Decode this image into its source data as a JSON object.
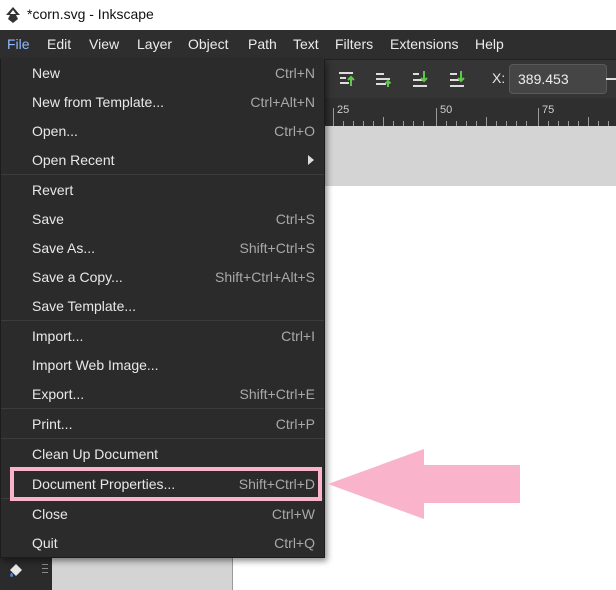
{
  "window": {
    "title": "*corn.svg - Inkscape"
  },
  "menubar": {
    "items": [
      "File",
      "Edit",
      "View",
      "Layer",
      "Object",
      "Path",
      "Text",
      "Filters",
      "Extensions",
      "Help"
    ]
  },
  "toolbar": {
    "x_label": "X:",
    "x_value": "389.453"
  },
  "ruler": {
    "labels": [
      "25",
      "50",
      "75"
    ]
  },
  "file_menu": {
    "items": [
      {
        "label": "New",
        "shortcut": "Ctrl+N"
      },
      {
        "label": "New from Template...",
        "shortcut": "Ctrl+Alt+N"
      },
      {
        "label": "Open...",
        "shortcut": "Ctrl+O"
      },
      {
        "label": "Open Recent",
        "shortcut": ""
      },
      {
        "label": "Revert",
        "shortcut": ""
      },
      {
        "label": "Save",
        "shortcut": "Ctrl+S"
      },
      {
        "label": "Save As...",
        "shortcut": "Shift+Ctrl+S"
      },
      {
        "label": "Save a Copy...",
        "shortcut": "Shift+Ctrl+Alt+S"
      },
      {
        "label": "Save Template...",
        "shortcut": ""
      },
      {
        "label": "Import...",
        "shortcut": "Ctrl+I"
      },
      {
        "label": "Import Web Image...",
        "shortcut": ""
      },
      {
        "label": "Export...",
        "shortcut": "Shift+Ctrl+E"
      },
      {
        "label": "Print...",
        "shortcut": "Ctrl+P"
      },
      {
        "label": "Clean Up Document",
        "shortcut": ""
      },
      {
        "label": "Document Properties...",
        "shortcut": "Shift+Ctrl+D"
      },
      {
        "label": "Close",
        "shortcut": "Ctrl+W"
      },
      {
        "label": "Quit",
        "shortcut": "Ctrl+Q"
      }
    ]
  },
  "colors": {
    "menu_bg": "#2b2b2b",
    "active_menu": "#8fb8ff",
    "highlight": "#f9b3ca",
    "align_icon_green": "#5fc84a"
  },
  "icons": {
    "app": "inkscape-logo-icon",
    "submenu": "chevron-right-icon",
    "pointer": "pink-arrow-icon"
  }
}
